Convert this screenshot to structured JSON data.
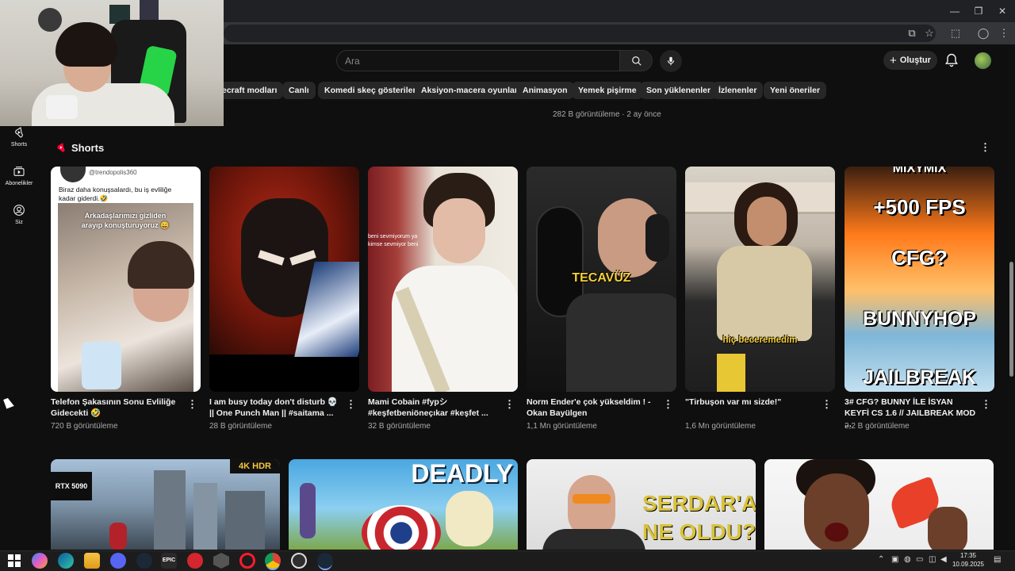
{
  "search": {
    "placeholder": "Ara"
  },
  "header": {
    "create_label": "Oluştur"
  },
  "chips": [
    "ecraft modları",
    "Canlı",
    "Komedi skeç gösterileri",
    "Aksiyon-macera oyunları",
    "Animasyon",
    "Yemek pişirme",
    "Son yüklenenler",
    "İzlenenler",
    "Yeni öneriler"
  ],
  "nav": [
    {
      "label": "Shorts",
      "icon": "shorts-icon"
    },
    {
      "label": "Abonelikler",
      "icon": "subscriptions-icon"
    },
    {
      "label": "Siz",
      "icon": "you-icon"
    }
  ],
  "prev_meta": "282 B görüntüleme · 2 ay önce",
  "shorts_section": {
    "title": "Shorts",
    "items": [
      {
        "title": "Telefon Şakasının Sonu Evliliğe Gidecekti 🤣",
        "views": "720 B görüntüleme",
        "thumb_handle": "@trendopolis360",
        "thumb_text": "Biraz daha konuşsalardı, bu iş evliliğe kadar giderdi.🤣",
        "thumb_caption": "Arkadaşlarımızı gizliden arayıp konuşturuyoruz 😄"
      },
      {
        "title": "I am busy today don't disturb 💀 || One Punch Man || #saitama ...",
        "views": "28 B görüntüleme"
      },
      {
        "title": "Mami Cobain #fypシ #keşfetbeniöneçıkar #keşfet ...",
        "views": "32 B görüntüleme",
        "thumb_text": "beni sevmiyorum ya\nkimse sevmiyor beni"
      },
      {
        "title": "Norm Ender'e çok yükseldim ! - Okan Bayülgen",
        "views": "1,1 Mn görüntüleme",
        "thumb_caption": "TECAVÜZ"
      },
      {
        "title": "\"Tirbuşon var mı sizde!\"",
        "views": "1,6 Mn görüntüleme",
        "thumb_caption": "hiç beceremedim"
      },
      {
        "title": "3# CFG? BUNNY İLE İSYAN KEYFİ CS 1.6 // JAILBREAK MOD ...",
        "views": "2,2 B görüntüleme",
        "thumb_lines": [
          "MIXYMIX",
          "+500 FPS",
          "CFG?",
          "BUNNYHOP",
          "JAILBREAK"
        ]
      }
    ]
  },
  "videos": [
    {
      "badge": "4K HDR",
      "thumb_text": "RTX 5090"
    },
    {
      "thumb_text": "DEADLY"
    },
    {
      "thumb_text": "SERDAR'A\nNE OLDU?"
    },
    {
      "thumb_text": ""
    }
  ],
  "taskbar": {
    "apps": [
      "windows-start-icon",
      "copilot-icon",
      "edge-icon",
      "file-explorer-icon",
      "discord-icon",
      "steam-icon",
      "epic-games-icon",
      "app-red-icon",
      "app-hex-icon",
      "opera-icon",
      "chrome-icon",
      "obs-icon",
      "steam-2-icon"
    ],
    "epic_label": "EPIC",
    "time": "17:35",
    "date": "10.09.2025"
  },
  "colors": {
    "accent_red": "#ff0033",
    "chip_bg": "#272727",
    "page_bg": "#0f0f0f"
  }
}
